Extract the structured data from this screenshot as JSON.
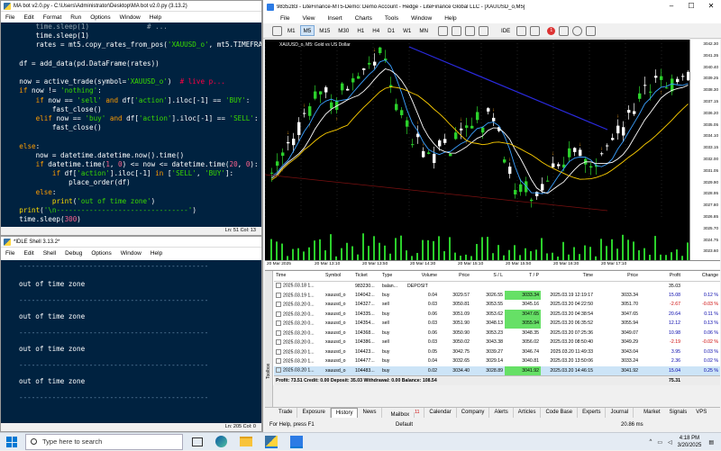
{
  "editor": {
    "title": "MA bot v2.0.py - C:\\Users\\Administrator\\Desktop\\MA bot v2.0.py (3.13.2)",
    "menu": [
      "File",
      "Edit",
      "Format",
      "Run",
      "Options",
      "Window",
      "Help"
    ],
    "status": "Ln: 51   Col: 13"
  },
  "shell": {
    "title": "*IDLE Shell 3.13.2*",
    "menu": [
      "File",
      "Edit",
      "Shell",
      "Debug",
      "Options",
      "Window",
      "Help"
    ],
    "dashes": "----------------------------------------------",
    "message": "out of time zone",
    "status": "Ln: 205   Col: 0"
  },
  "mt5": {
    "title": "9835283 - LiteFinance-MT5-Demo: Demo Account - Hedge - LiteFinance Global LLC - [XAUUSD_o,M5]",
    "menu": [
      "File",
      "View",
      "Insert",
      "Charts",
      "Tools",
      "Window",
      "Help"
    ],
    "timeframes": [
      "M1",
      "M5",
      "M15",
      "M30",
      "H1",
      "H4",
      "D1",
      "W1",
      "MN"
    ],
    "active_timeframe": "M5",
    "ide_label": "IDE",
    "notification_count": "1",
    "chart_label": "XAUUSD_o, M5: Gold vs US Dollar",
    "price_ticks": [
      "3042.30",
      "3041.35",
      "3040.40",
      "3039.25",
      "3038.30",
      "3037.15",
      "3036.20",
      "3035.05",
      "3034.10",
      "3033.15",
      "3032.00",
      "3031.05",
      "3029.90",
      "3028.95",
      "3027.80",
      "3026.85",
      "3025.70",
      "3024.75",
      "3023.60"
    ],
    "time_ticks": [
      "20 Mar 2025",
      "20 Mar 13:10",
      "20 Mar 13:50",
      "20 Mar 14:30",
      "20 Mar 15:10",
      "20 Mar 15:50",
      "20 Mar 16:30",
      "20 Mar 17:10"
    ],
    "toolbox_label": "Toolbox",
    "table_headers": [
      "Time",
      "Symbol",
      "Ticket",
      "Type",
      "Volume",
      "Price",
      "S / L",
      "T / P",
      "Time",
      "Price",
      "Profit",
      "Change"
    ],
    "deposit_row": {
      "time": "2025.03.18 1...",
      "ticket": "983230...",
      "type": "balan...",
      "volume": "DEPOSIT",
      "profit": "35.03"
    },
    "rows": [
      {
        "time": "2025.03.19 1...",
        "symbol": "xauusd_o",
        "ticket": "104042...",
        "type": "buy",
        "volume": "0.04",
        "price": "3029.57",
        "sl": "3026.55",
        "tp": "3033.34",
        "ctime": "2025.03.19 12:19:17",
        "cprice": "3033.34",
        "profit": "15.08",
        "change": "0.12 %",
        "tp_hit": true
      },
      {
        "time": "2025.03.20 0...",
        "symbol": "xauusd_o",
        "ticket": "104327...",
        "type": "sell",
        "volume": "0.03",
        "price": "3050.81",
        "sl": "3053.55",
        "tp": "3045.16",
        "ctime": "2025.03.20 04:22:50",
        "cprice": "3051.70",
        "profit": "-2.67",
        "change": "-0.03 %",
        "tp_hit": false
      },
      {
        "time": "2025.03.20 0...",
        "symbol": "xauusd_o",
        "ticket": "104335...",
        "type": "buy",
        "volume": "0.06",
        "price": "3051.09",
        "sl": "3053.62",
        "tp": "3047.65",
        "ctime": "2025.03.20 04:38:54",
        "cprice": "3047.65",
        "profit": "20.64",
        "change": "0.11 %",
        "tp_hit": true
      },
      {
        "time": "2025.03.20 0...",
        "symbol": "xauusd_o",
        "ticket": "104354...",
        "type": "sell",
        "volume": "0.03",
        "price": "3051.90",
        "sl": "3048.13",
        "tp": "3055.94",
        "ctime": "2025.03.20 06:35:52",
        "cprice": "3055.94",
        "profit": "12.12",
        "change": "0.13 %",
        "tp_hit": true
      },
      {
        "time": "2025.03.20 0...",
        "symbol": "xauusd_o",
        "ticket": "104368...",
        "type": "buy",
        "volume": "0.06",
        "price": "3050.90",
        "sl": "3053.23",
        "tp": "3048.35",
        "ctime": "2025.03.20 07:25:36",
        "cprice": "3049.07",
        "profit": "10.98",
        "change": "0.06 %",
        "tp_hit": false
      },
      {
        "time": "2025.03.20 0...",
        "symbol": "xauusd_o",
        "ticket": "104386...",
        "type": "sell",
        "volume": "0.03",
        "price": "3050.02",
        "sl": "3043.38",
        "tp": "3056.02",
        "ctime": "2025.03.20 08:50:40",
        "cprice": "3049.29",
        "profit": "-2.19",
        "change": "-0.02 %",
        "tp_hit": false
      },
      {
        "time": "2025.03.20 1...",
        "symbol": "xauusd_o",
        "ticket": "104423...",
        "type": "buy",
        "volume": "0.05",
        "price": "3042.75",
        "sl": "3039.27",
        "tp": "3046.74",
        "ctime": "2025.03.20 11:49:33",
        "cprice": "3043.04",
        "profit": "3.95",
        "change": "0.03 %",
        "tp_hit": false
      },
      {
        "time": "2025.03.20 1...",
        "symbol": "xauusd_o",
        "ticket": "104477...",
        "type": "buy",
        "volume": "0.04",
        "price": "3032.65",
        "sl": "3029.14",
        "tp": "3040.81",
        "ctime": "2025.03.20 13:50:06",
        "cprice": "3033.24",
        "profit": "2.36",
        "change": "0.02 %",
        "tp_hit": false
      },
      {
        "time": "2025.03.20 1...",
        "symbol": "xauusd_o",
        "ticket": "104483...",
        "type": "buy",
        "volume": "0.02",
        "price": "3034.40",
        "sl": "3028.89",
        "tp": "3041.92",
        "ctime": "2025.03.20 14:46:15",
        "cprice": "3041.92",
        "profit": "15.04",
        "change": "0.25 %",
        "tp_hit": true
      }
    ],
    "summary": "Profit: 73.51   Credit: 0.00   Deposit: 35.03   Withdrawal: 0.00   Balance: 108.54",
    "summary_total": "75.31",
    "bottom_tabs": [
      "Trade",
      "Exposure",
      "History",
      "News",
      "Mailbox",
      "Calendar",
      "Company",
      "Alerts",
      "Articles",
      "Code Base",
      "Experts",
      "Journal"
    ],
    "active_bottom_tab": "History",
    "mailbox_badge": "11",
    "market_label": "Market",
    "signals_label": "Signals",
    "vps_label": "VPS",
    "status_help": "For Help, press F1",
    "status_default": "Default",
    "status_speed": "20.86 ms"
  },
  "taskbar": {
    "search_placeholder": "Type here to search",
    "time": "4:18 PM",
    "date": "3/20/2025"
  }
}
